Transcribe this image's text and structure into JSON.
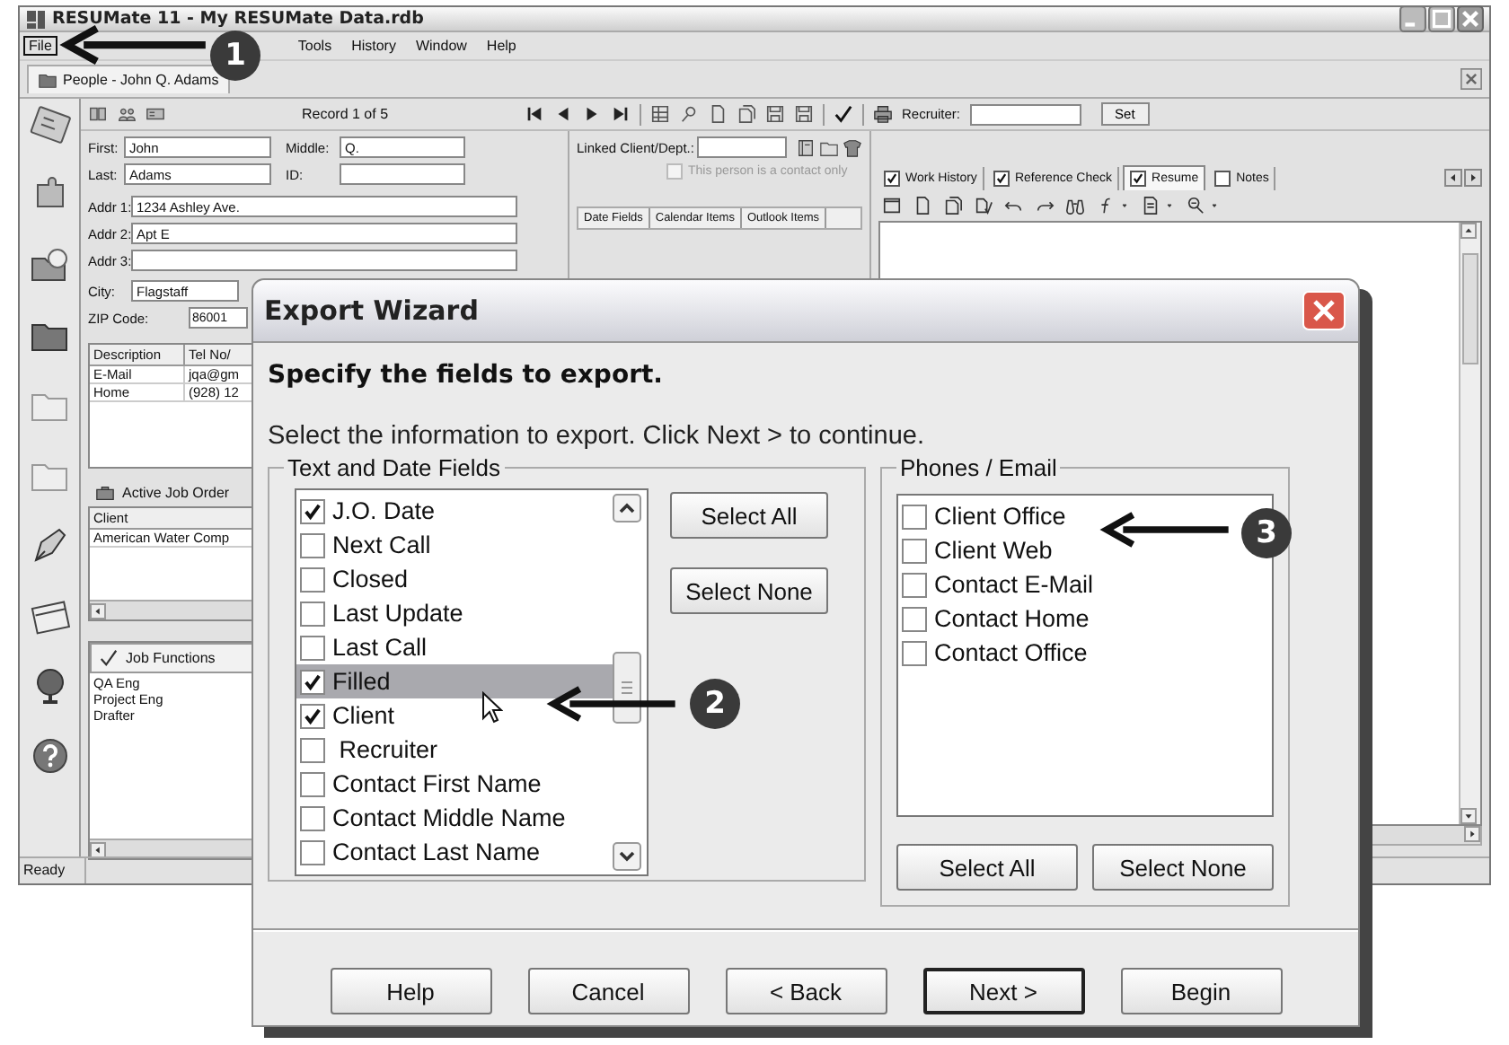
{
  "app": {
    "title": "RESUMate 11 - My RESUMate Data.rdb",
    "menu": [
      {
        "label": "File",
        "selected": true
      },
      {
        "label": "Tools",
        "selected": false
      },
      {
        "label": "History",
        "selected": false
      },
      {
        "label": "Window",
        "selected": false
      },
      {
        "label": "Help",
        "selected": false
      }
    ],
    "doc_tab": "People - John Q. Adams",
    "status": "Ready",
    "toolbar": {
      "record": "Record 1 of 5",
      "recruiter_label": "Recruiter:",
      "set_button": "Set"
    },
    "name_rows": [
      [
        {
          "label": "First:",
          "value": "John"
        },
        {
          "label": "Middle:",
          "value": "Q."
        }
      ],
      [
        {
          "label": "Last:",
          "value": "Adams"
        },
        {
          "label": "ID:"
        }
      ]
    ],
    "address_rows": [
      {
        "label": "Addr 1:",
        "value": "1234 Ashley Ave."
      },
      {
        "label": "Addr 2:",
        "value": "Apt E"
      },
      {
        "label": "Addr 3:"
      }
    ],
    "city": {
      "label": "City:",
      "value": "Flagstaff"
    },
    "zip": {
      "label": "ZIP Code:",
      "value": "86001"
    },
    "phones": {
      "columns": [
        "Description",
        "Tel No/"
      ],
      "rows": [
        [
          "E-Mail",
          "jqa@gm"
        ],
        [
          "Home",
          "(928) 12"
        ]
      ]
    },
    "job_orders": {
      "title": "Active Job Order",
      "column": "Client",
      "rows": [
        "American Water Comp"
      ]
    },
    "job_functions": {
      "title": "Job Functions",
      "rows": [
        "QA Eng",
        "Project Eng",
        "Drafter"
      ]
    },
    "linked": {
      "label": "Linked Client/Dept.:",
      "contact_only": {
        "label": "This person is a contact only",
        "checked": false,
        "disabled": true
      }
    },
    "mid_tabs": [
      "Date Fields",
      "Calendar Items",
      "Outlook Items"
    ],
    "right_tabs": [
      {
        "label": "Work History",
        "checked": true,
        "selected": false
      },
      {
        "label": "Reference Check",
        "checked": true,
        "selected": false
      },
      {
        "label": "Resume",
        "checked": true,
        "selected": true
      },
      {
        "label": "Notes",
        "checked": false,
        "selected": false
      }
    ]
  },
  "dialog": {
    "title": "Export Wizard",
    "heading": "Specify the fields to export.",
    "instruction": "Select the information to export. Click Next > to continue.",
    "text_group": {
      "label": "Text and Date Fields",
      "select_all": "Select All",
      "select_none": "Select None",
      "items": [
        {
          "label": "J.O. Date",
          "checked": true,
          "selected": false
        },
        {
          "label": "Next Call",
          "checked": false,
          "selected": false
        },
        {
          "label": "Closed",
          "checked": false,
          "selected": false
        },
        {
          "label": "Last Update",
          "checked": false,
          "selected": false
        },
        {
          "label": "Last Call",
          "checked": false,
          "selected": false
        },
        {
          "label": "Filled",
          "checked": true,
          "selected": true
        },
        {
          "label": "Client",
          "checked": true,
          "selected": false
        },
        {
          "label": " Recruiter",
          "checked": false,
          "selected": false
        },
        {
          "label": "Contact First Name",
          "checked": false,
          "selected": false
        },
        {
          "label": "Contact Middle Name",
          "checked": false,
          "selected": false
        },
        {
          "label": "Contact Last Name",
          "checked": false,
          "selected": false
        }
      ]
    },
    "phone_group": {
      "label": "Phones / Email",
      "select_all": "Select All",
      "select_none": "Select None",
      "items": [
        {
          "label": "Client Office",
          "checked": false
        },
        {
          "label": "Client Web",
          "checked": false
        },
        {
          "label": "Contact E-Mail",
          "checked": false
        },
        {
          "label": "Contact Home",
          "checked": false
        },
        {
          "label": "Contact Office",
          "checked": false
        }
      ]
    },
    "buttons": [
      {
        "label": "Help",
        "default": false
      },
      {
        "label": "Cancel",
        "default": false
      },
      {
        "label": "< Back",
        "default": false
      },
      {
        "label": "Next >",
        "default": true
      },
      {
        "label": "Begin",
        "default": false
      }
    ]
  },
  "callouts": [
    "1",
    "2",
    "3"
  ]
}
